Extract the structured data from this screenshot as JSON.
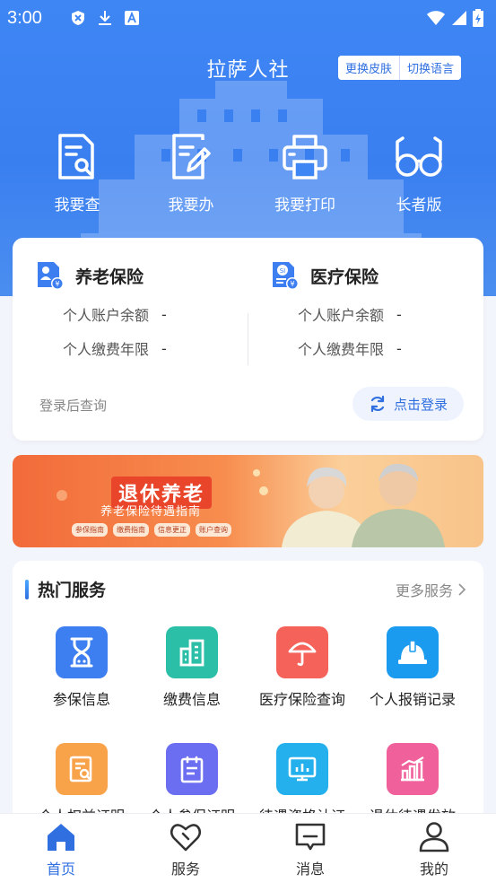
{
  "status_bar": {
    "time": "3:00"
  },
  "header": {
    "title": "拉萨人社",
    "skin_button": "更换皮肤",
    "language_button": "切换语言"
  },
  "quick_actions": [
    {
      "label": "我要查",
      "icon": "document-search-icon"
    },
    {
      "label": "我要办",
      "icon": "document-edit-icon"
    },
    {
      "label": "我要打印",
      "icon": "printer-icon"
    },
    {
      "label": "长者版",
      "icon": "glasses-icon"
    }
  ],
  "insurance": {
    "pension": {
      "title": "养老保险",
      "balance_label": "个人账户余额",
      "balance_value": "-",
      "years_label": "个人缴费年限",
      "years_value": "-"
    },
    "medical": {
      "title": "医疗保险",
      "balance_label": "个人账户余额",
      "balance_value": "-",
      "years_label": "个人缴费年限",
      "years_value": "-"
    },
    "hint": "登录后查询",
    "login_button": "点击登录"
  },
  "banner": {
    "title": "退休养老",
    "subtitle": "养老保险待遇指南",
    "tags": [
      "参保指南",
      "缴费指南",
      "信息更正",
      "账户查询"
    ]
  },
  "services": {
    "title": "热门服务",
    "more": "更多服务",
    "items": [
      {
        "label": "参保信息",
        "icon": "hourglass-icon",
        "color": "#3d7ef0"
      },
      {
        "label": "缴费信息",
        "icon": "building-icon",
        "color": "#2bbfa8"
      },
      {
        "label": "医疗保险查询",
        "icon": "umbrella-icon",
        "color": "#f4625a"
      },
      {
        "label": "个人报销记录",
        "icon": "helmet-icon",
        "color": "#1a9bf0"
      },
      {
        "label": "个人权益证明",
        "icon": "document-search-icon",
        "color": "#f8a24a"
      },
      {
        "label": "个人参保证明",
        "icon": "clipboard-icon",
        "color": "#6b6ef0"
      },
      {
        "label": "待遇资格认证",
        "icon": "monitor-chart-icon",
        "color": "#24b0ec"
      },
      {
        "label": "退休待遇发放",
        "icon": "bar-chart-icon",
        "color": "#f0609a"
      }
    ]
  },
  "tabbar": [
    {
      "label": "首页",
      "icon": "home-icon",
      "active": true
    },
    {
      "label": "服务",
      "icon": "heart-icon",
      "active": false
    },
    {
      "label": "消息",
      "icon": "message-icon",
      "active": false
    },
    {
      "label": "我的",
      "icon": "user-icon",
      "active": false
    }
  ],
  "colors": {
    "primary": "#2f6fe0",
    "hero": "#3f86f5",
    "banner": "#f26b3a"
  }
}
